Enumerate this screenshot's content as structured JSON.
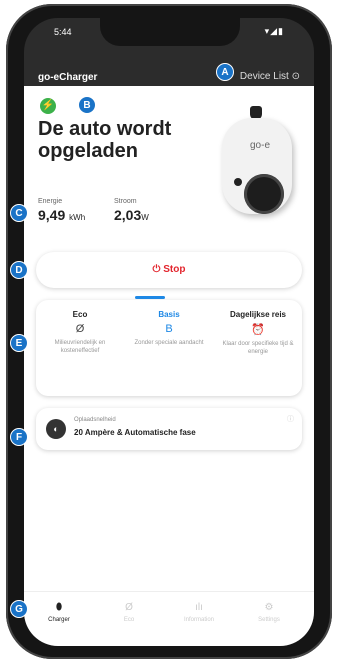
{
  "status_bar": {
    "time": "5:44",
    "signal": "▾◢▮"
  },
  "app": {
    "title": "go-eCharger",
    "device_list": "Device List"
  },
  "status": {
    "headline": "De auto wordt opgeladen"
  },
  "charger": {
    "logo": "go-e"
  },
  "stats": [
    {
      "label": "Energie",
      "value": "9,49",
      "unit": "kWh"
    },
    {
      "label": "Stroom",
      "value": "2,03",
      "unit": "W"
    }
  ],
  "stop": {
    "label": "Stop"
  },
  "modes": [
    {
      "title": "Eco",
      "icon": "Ø",
      "desc": "Milieuvriendelijk en kosteneffectief"
    },
    {
      "title": "Basis",
      "icon": "B",
      "desc": "Zonder speciale aandacht"
    },
    {
      "title": "Dagelijkse reis",
      "icon": "⏰",
      "desc": "Klaar door specifieke tijd & energie"
    }
  ],
  "speed": {
    "label": "Oplaadsnelheid",
    "value": "20 Ampère & Automatische fase"
  },
  "tabs": [
    {
      "label": "Charger"
    },
    {
      "label": "Eco"
    },
    {
      "label": "Information"
    },
    {
      "label": "Settings"
    }
  ],
  "callouts": [
    "A",
    "B",
    "C",
    "D",
    "E",
    "F",
    "G"
  ],
  "colors": {
    "accent": "#1e88e5",
    "stop": "#e3262e",
    "callout": "#1a73c7",
    "charging": "#3cb14a"
  }
}
